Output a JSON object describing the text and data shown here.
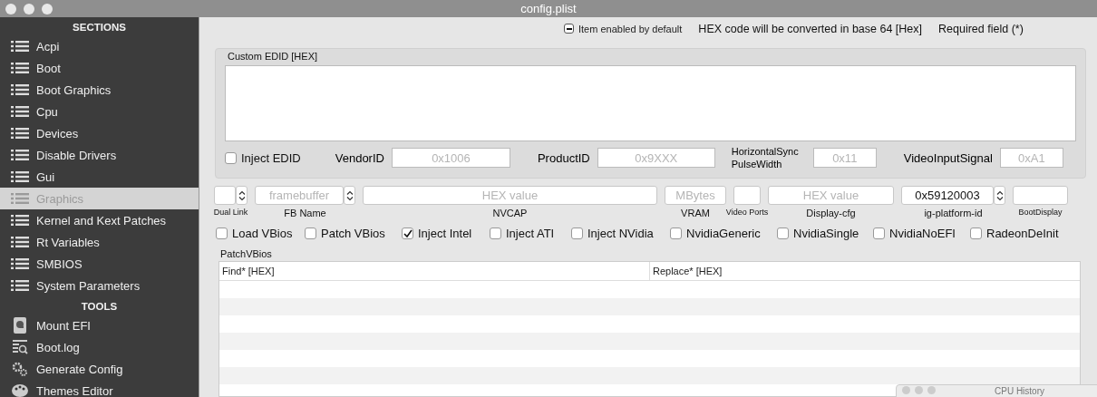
{
  "window": {
    "title": "config.plist"
  },
  "sidebar": {
    "sections_heading": "SECTIONS",
    "items": [
      {
        "label": "Acpi",
        "selected": false
      },
      {
        "label": "Boot",
        "selected": false
      },
      {
        "label": "Boot Graphics",
        "selected": false
      },
      {
        "label": "Cpu",
        "selected": false
      },
      {
        "label": "Devices",
        "selected": false
      },
      {
        "label": "Disable Drivers",
        "selected": false
      },
      {
        "label": "Gui",
        "selected": false
      },
      {
        "label": "Graphics",
        "selected": true
      },
      {
        "label": "Kernel and Kext Patches",
        "selected": false
      },
      {
        "label": "Rt Variables",
        "selected": false
      },
      {
        "label": "SMBIOS",
        "selected": false
      },
      {
        "label": "System Parameters",
        "selected": false
      }
    ],
    "tools_heading": "TOOLS",
    "tools": [
      {
        "label": "Mount EFI",
        "kind": "disk"
      },
      {
        "label": "Boot.log",
        "kind": "log"
      },
      {
        "label": "Generate Config",
        "kind": "gears"
      },
      {
        "label": "Themes Editor",
        "kind": "palette"
      }
    ]
  },
  "topbar": {
    "legend": {
      "label": "Item enabled by default",
      "mixed": true
    },
    "hex_note": "HEX code will be converted in base 64 [Hex]",
    "required_note": "Required field (*)"
  },
  "custom_edid": {
    "title": "Custom EDID [HEX]",
    "inject": {
      "label": "Inject EDID",
      "checked": false
    },
    "fields": [
      {
        "label": "VendorID",
        "placeholder": "0x1006"
      },
      {
        "label": "ProductID",
        "placeholder": "0x9XXX"
      },
      {
        "label": "HorizontalSync PulseWidth",
        "placeholder": "0x11"
      },
      {
        "label": "VideoInputSignal",
        "placeholder": "0xA1"
      }
    ]
  },
  "graphics_fields": [
    {
      "caption": "Dual Link",
      "stepper": true,
      "small": true
    },
    {
      "caption": "FB Name",
      "placeholder": "framebuffer",
      "stepper": true,
      "small": false
    },
    {
      "caption": "NVCAP",
      "placeholder": "HEX value",
      "stepper": false,
      "small": false
    },
    {
      "caption": "VRAM",
      "placeholder": "MBytes",
      "stepper": false,
      "small": false
    },
    {
      "caption": "Video Ports",
      "stepper": false,
      "small": true
    },
    {
      "caption": "Display-cfg",
      "placeholder": "HEX value",
      "stepper": false,
      "small": false
    },
    {
      "caption": "ig-platform-id",
      "value": "0x59120003",
      "stepper": true,
      "small": false
    },
    {
      "caption": "BootDisplay",
      "stepper": false,
      "small": true
    }
  ],
  "options": [
    {
      "label": "Load VBios",
      "checked": false
    },
    {
      "label": "Patch VBios",
      "checked": false
    },
    {
      "label": "Inject Intel",
      "checked": true
    },
    {
      "label": "Inject ATI",
      "checked": false
    },
    {
      "label": "Inject NVidia",
      "checked": false
    },
    {
      "label": "NvidiaGeneric",
      "checked": false
    },
    {
      "label": "NvidiaSingle",
      "checked": false
    },
    {
      "label": "NvidiaNoEFI",
      "checked": false
    },
    {
      "label": "RadeonDeInit",
      "checked": false
    }
  ],
  "patch_vbios": {
    "title": "PatchVBios",
    "columns": [
      "Find* [HEX]",
      "Replace* [HEX]"
    ]
  },
  "cpu_history": {
    "title": "CPU History"
  }
}
